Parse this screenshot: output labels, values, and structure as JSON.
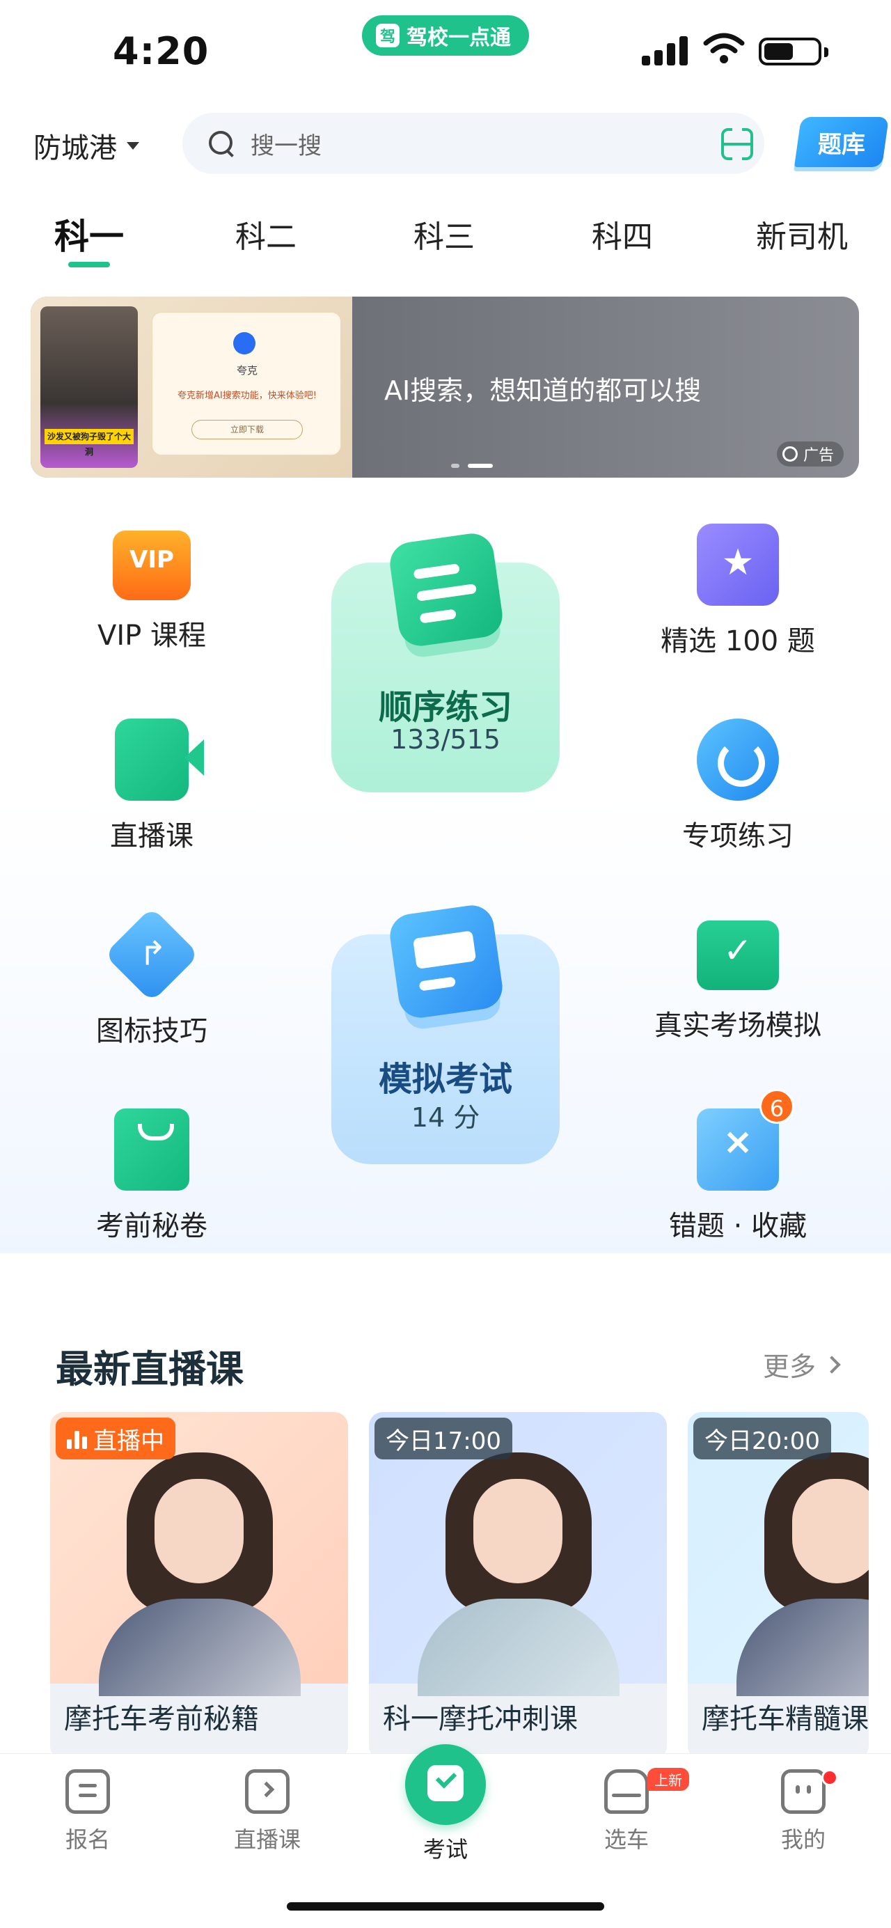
{
  "status_bar": {
    "time": "4:20",
    "app_name": "驾校一点通",
    "app_icon_glyph": "驾",
    "battery_fraction": 0.55
  },
  "header": {
    "city": "防城港",
    "search_placeholder": "搜一搜",
    "tiku_label": "题库"
  },
  "tabs": [
    "科一",
    "科二",
    "科三",
    "科四",
    "新司机"
  ],
  "active_tab": "科一",
  "banner": {
    "headline": "AI搜索，想知道的都可以搜",
    "ad_label": "广告",
    "image_card_name": "夸克",
    "image_card_desc": "夸克新增AI搜索功能，快来体验吧!",
    "image_card_button": "立即下载",
    "image_photo_caption": "沙发又被狗子毁了个大洞",
    "dots": 2,
    "active_dot": 2
  },
  "features": {
    "vip": {
      "label": "VIP 课程",
      "icon": "vip-icon",
      "icon_text": "VIP"
    },
    "select100": {
      "label": "精选 100 题",
      "icon": "star-icon",
      "icon_text": "★"
    },
    "live": {
      "label": "直播课",
      "icon": "camera-icon"
    },
    "special": {
      "label": "专项练习",
      "icon": "target-icon"
    },
    "tips": {
      "label": "图标技巧",
      "icon": "arrow-icon",
      "icon_text": "↱"
    },
    "real_exam": {
      "label": "真实考场模拟",
      "icon": "screen-check-icon",
      "icon_text": "✓"
    },
    "secret": {
      "label": "考前秘卷",
      "icon": "bag-icon"
    },
    "mistakes": {
      "label": "错题 · 收藏",
      "icon": "x-card-icon",
      "icon_text": "×",
      "badge": "6"
    }
  },
  "practice": {
    "title": "顺序练习",
    "progress": "133/515"
  },
  "mock_exam": {
    "title": "模拟考试",
    "score": "14 分"
  },
  "live_section": {
    "title": "最新直播课",
    "more": "更多",
    "cards": [
      {
        "tag": "直播中",
        "name": "摩托车考前秘籍"
      },
      {
        "tag": "今日17:00",
        "name": "科一摩托冲刺课"
      },
      {
        "tag": "今日20:00",
        "name": "摩托车精髓课"
      }
    ]
  },
  "bottom_nav": {
    "items": [
      "报名",
      "直播课",
      "考试",
      "选车",
      "我的"
    ],
    "active": "考试",
    "new_badge": "上新"
  },
  "colors": {
    "brand_green": "#1fc28a",
    "accent_orange": "#ff6a1a",
    "accent_blue": "#2a8df2"
  }
}
